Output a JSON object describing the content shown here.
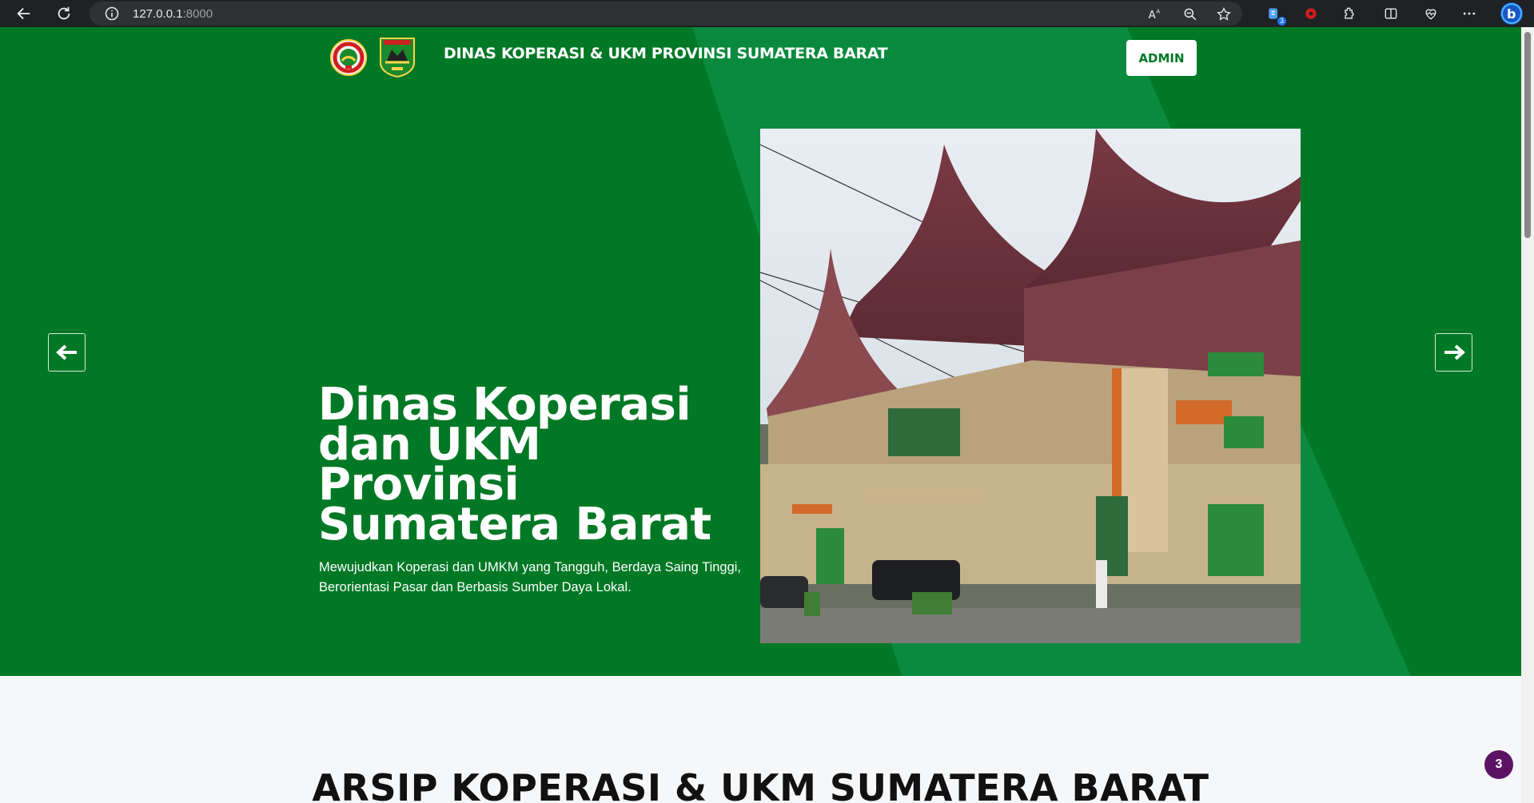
{
  "browser": {
    "url_host": "127.0.0.1",
    "url_port": ":8000",
    "extension_badge": "3",
    "icons": [
      "back-icon",
      "reload-icon",
      "info-icon",
      "read-aloud-icon",
      "zoom-icon",
      "favorite-icon",
      "extension-icon",
      "record-icon",
      "extensions-icon",
      "split-screen-icon",
      "health-icon",
      "more-icon",
      "bing-icon"
    ]
  },
  "header": {
    "brand": "DINAS KOPERASI & UKM PROVINSI SUMATERA BARAT",
    "admin_label": "ADMIN"
  },
  "hero": {
    "title": "Dinas Koperasi dan UKM Provinsi Sumatera Barat",
    "subtitle": "Mewujudkan Koperasi dan UMKM yang Tangguh, Berdaya Saing Tinggi, Berorientasi Pasar dan Berbasis Sumber Daya Lokal.",
    "background_color": "#017825",
    "accent_color": "#0a8a3e"
  },
  "section": {
    "title": "ARSIP KOPERASI & UKM SUMATERA BARAT"
  },
  "notification": {
    "count": "3",
    "color": "#5b1463"
  }
}
